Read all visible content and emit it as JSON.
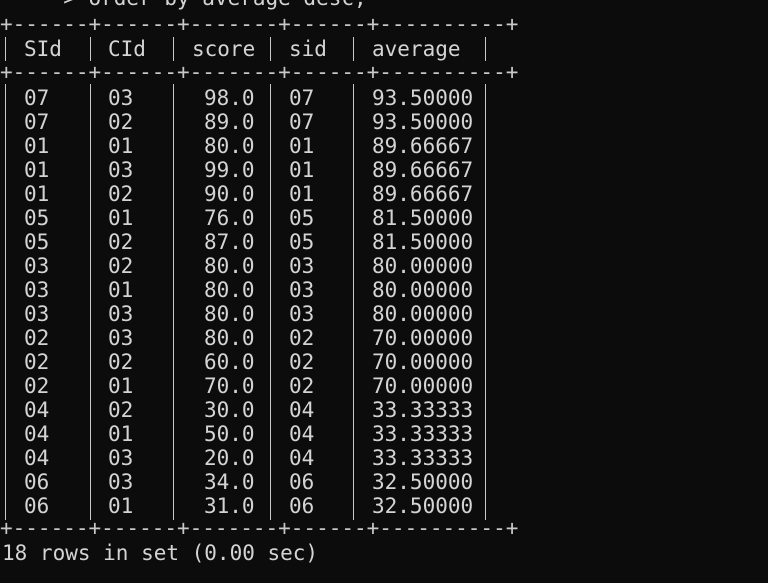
{
  "terminal": {
    "command_continuation": "    -> order by average desc;",
    "border_top": "+------+------+-------+------+----------+",
    "border_mid": "+------+------+-------+------+----------+",
    "border_bottom": "+------+------+-------+------+----------+",
    "columns": [
      "SId",
      "CId",
      "score",
      "sid",
      "average"
    ],
    "rows": [
      [
        "07",
        "03",
        "98.0",
        "07",
        "93.50000"
      ],
      [
        "07",
        "02",
        "89.0",
        "07",
        "93.50000"
      ],
      [
        "01",
        "01",
        "80.0",
        "01",
        "89.66667"
      ],
      [
        "01",
        "03",
        "99.0",
        "01",
        "89.66667"
      ],
      [
        "01",
        "02",
        "90.0",
        "01",
        "89.66667"
      ],
      [
        "05",
        "01",
        "76.0",
        "05",
        "81.50000"
      ],
      [
        "05",
        "02",
        "87.0",
        "05",
        "81.50000"
      ],
      [
        "03",
        "02",
        "80.0",
        "03",
        "80.00000"
      ],
      [
        "03",
        "01",
        "80.0",
        "03",
        "80.00000"
      ],
      [
        "03",
        "03",
        "80.0",
        "03",
        "80.00000"
      ],
      [
        "02",
        "03",
        "80.0",
        "02",
        "70.00000"
      ],
      [
        "02",
        "02",
        "60.0",
        "02",
        "70.00000"
      ],
      [
        "02",
        "01",
        "70.0",
        "02",
        "70.00000"
      ],
      [
        "04",
        "02",
        "30.0",
        "04",
        "33.33333"
      ],
      [
        "04",
        "01",
        "50.0",
        "04",
        "33.33333"
      ],
      [
        "04",
        "03",
        "20.0",
        "04",
        "33.33333"
      ],
      [
        "06",
        "03",
        "34.0",
        "06",
        "32.50000"
      ],
      [
        "06",
        "01",
        "31.0",
        "06",
        "32.50000"
      ]
    ],
    "footer": "18 rows in set (0.00 sec)"
  }
}
